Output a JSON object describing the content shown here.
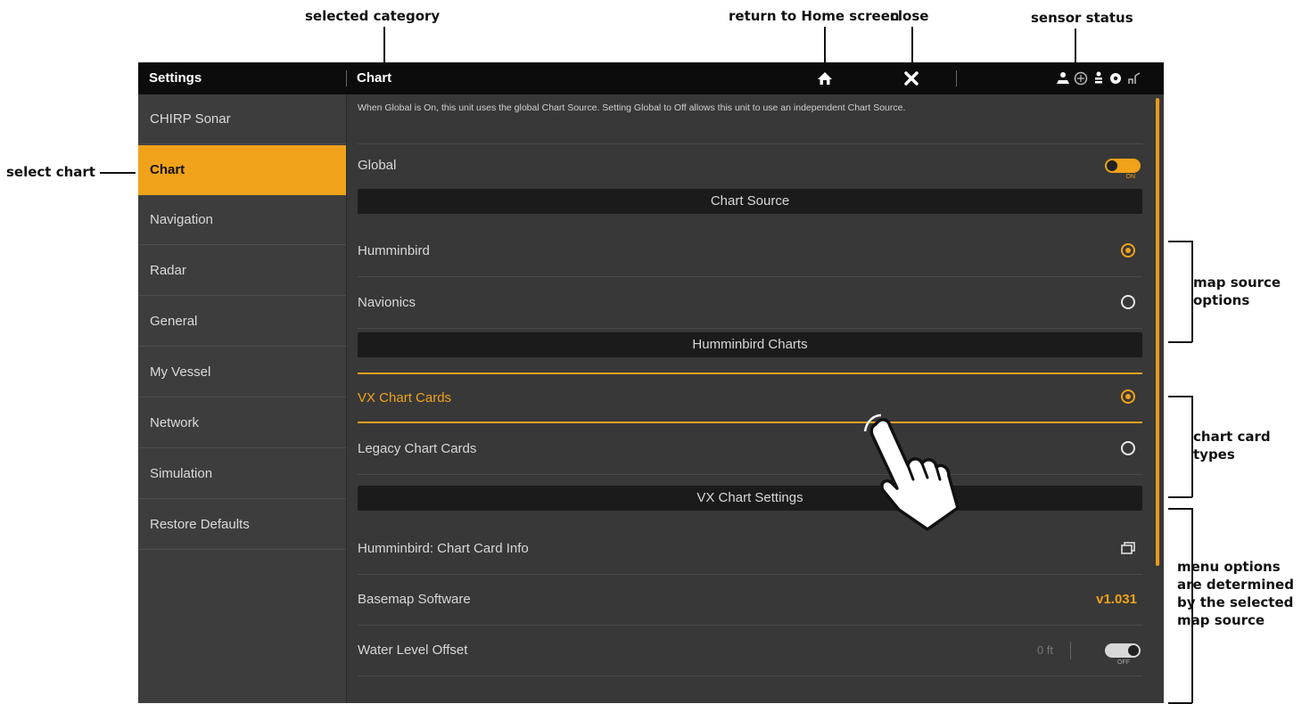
{
  "callouts": {
    "selected_category": "selected category",
    "return_home": "return to Home screen",
    "close": "close",
    "sensor_status": "sensor status",
    "select_chart": "select chart",
    "map_source_options": "map source options",
    "chart_card_types": "chart card types",
    "menu_options": "menu options are determined by the selected map source"
  },
  "topbar": {
    "settings_title": "Settings",
    "category_title": "Chart",
    "home_icon": "home-icon",
    "close_icon": "close-icon",
    "status_icons": [
      "boat-sensor-icon",
      "gps-icon",
      "depth-sensor-icon",
      "temp-sensor-icon",
      "network-icon"
    ]
  },
  "sidebar": {
    "items": [
      {
        "label": "CHIRP Sonar"
      },
      {
        "label": "Chart",
        "active": true
      },
      {
        "label": "Navigation"
      },
      {
        "label": "Radar"
      },
      {
        "label": "General"
      },
      {
        "label": "My Vessel"
      },
      {
        "label": "Network"
      },
      {
        "label": "Simulation"
      },
      {
        "label": "Restore Defaults"
      }
    ]
  },
  "content": {
    "description": "When Global is On, this unit uses the global Chart Source. Setting Global to Off allows this unit to use an independent Chart Source.",
    "global": {
      "label": "Global",
      "state": "ON"
    },
    "sections": {
      "chart_source": "Chart Source",
      "humminbird_charts": "Humminbird Charts",
      "vx_chart_settings": "VX Chart Settings"
    },
    "chart_source_options": [
      {
        "label": "Humminbird",
        "selected": true
      },
      {
        "label": "Navionics",
        "selected": false
      }
    ],
    "card_types": [
      {
        "label": "VX Chart Cards",
        "selected": true
      },
      {
        "label": "Legacy Chart Cards",
        "selected": false
      }
    ],
    "chart_card_info": "Humminbird: Chart Card Info",
    "basemap": {
      "label": "Basemap Software",
      "value": "v1.031"
    },
    "water_level": {
      "label": "Water Level Offset",
      "value": "0 ft",
      "state": "OFF"
    }
  },
  "colors": {
    "accent": "#f0a21a",
    "background": "#383838",
    "topbar": "#0c0c0c"
  }
}
